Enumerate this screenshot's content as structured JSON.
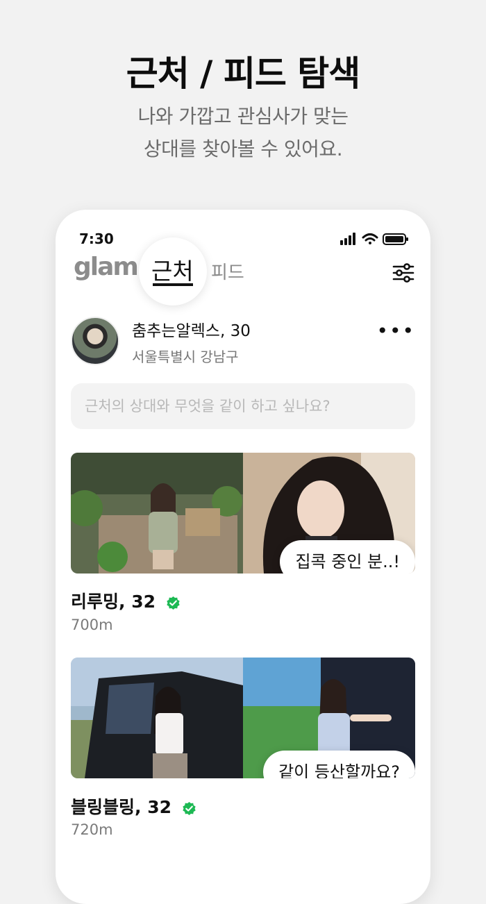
{
  "promo": {
    "title": "근처 / 피드 탐색",
    "subtitle_line1": "나와 가깝고 관심사가 맞는",
    "subtitle_line2": "상대를 찾아볼 수 있어요."
  },
  "status_bar": {
    "time": "7:30",
    "icons": [
      "signal-icon",
      "wifi-icon",
      "battery-icon"
    ]
  },
  "header": {
    "logo": "glam",
    "tabs": [
      {
        "label": "근처",
        "active": true
      },
      {
        "label": "피드",
        "active": false
      }
    ],
    "filter_icon": "sliders-icon"
  },
  "profile": {
    "name": "춤추는알렉스, 30",
    "location": "서울특별시 강남구",
    "more_icon": "more-horizontal-icon"
  },
  "composer": {
    "placeholder": "근처의 상대와 무엇을 같이 하고 싶나요?"
  },
  "cards": [
    {
      "name": "리루밍, 32",
      "distance": "700m",
      "bubble": "집콕 중인 분..!",
      "verified": true
    },
    {
      "name": "블링블링, 32",
      "distance": "720m",
      "bubble": "같이 등산할까요?",
      "verified": true
    }
  ],
  "colors": {
    "verified": "#1db954",
    "accent": "#111111",
    "muted": "#7a7a7a"
  }
}
